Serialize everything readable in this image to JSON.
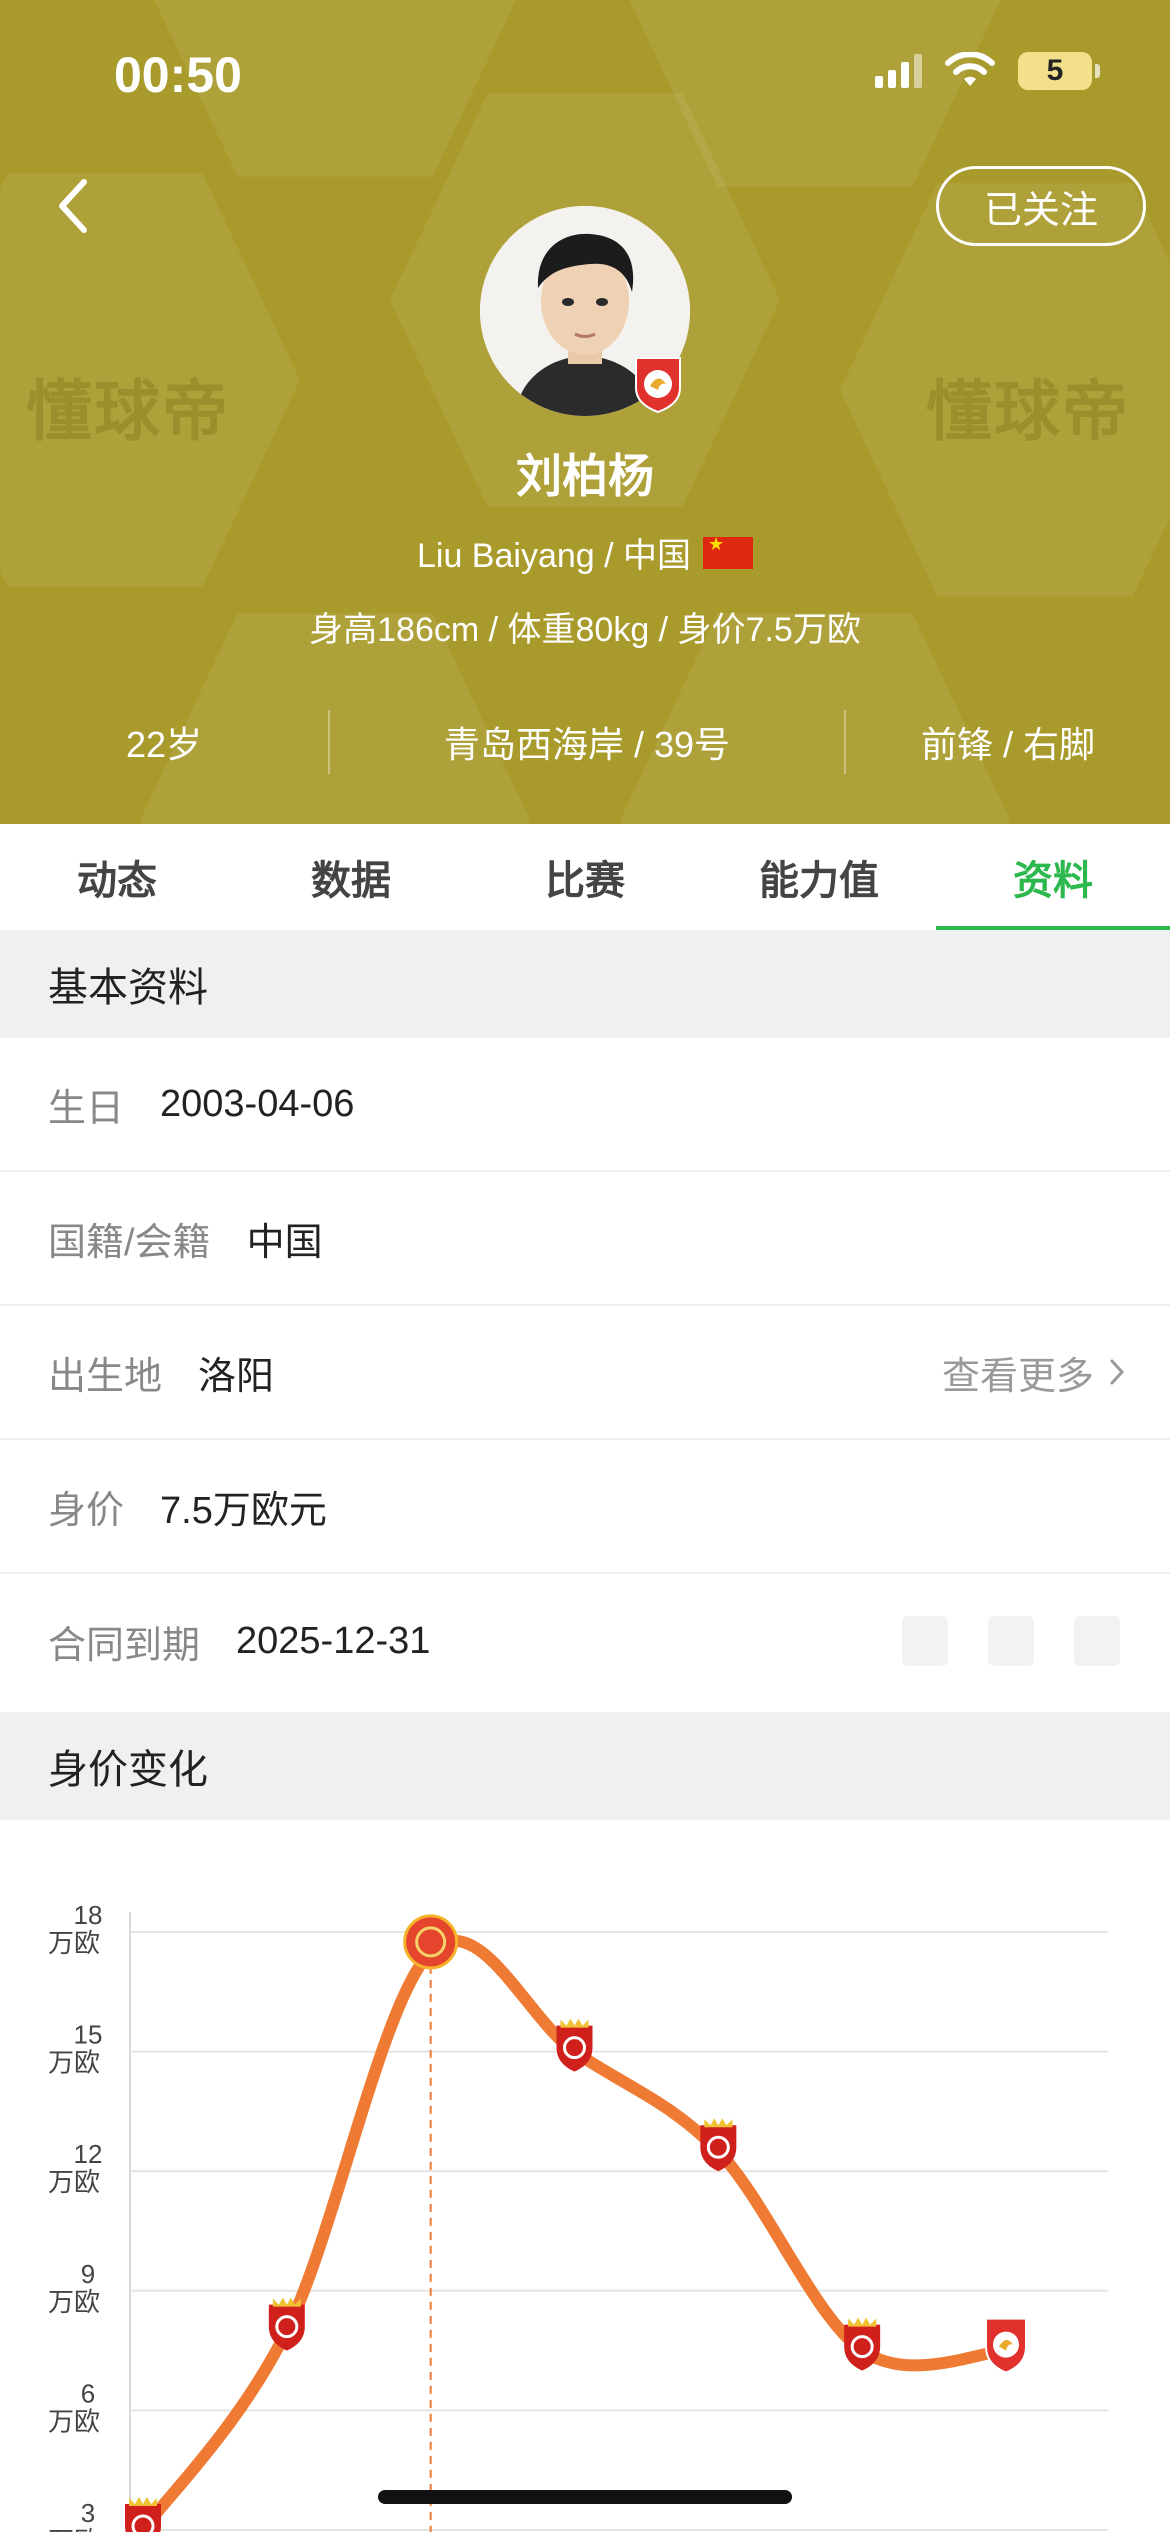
{
  "status_bar": {
    "time": "00:50",
    "battery": "5"
  },
  "header": {
    "watermark": "懂球帝",
    "follow_label": "已关注",
    "name": "刘柏杨",
    "latin_name": "Liu Baiyang / 中国",
    "body_info": "身高186cm / 体重80kg / 身价7.5万欧",
    "age": "22岁",
    "club_number": "青岛西海岸 / 39号",
    "position_foot": "前锋 / 右脚"
  },
  "tabs": [
    {
      "label": "动态"
    },
    {
      "label": "数据"
    },
    {
      "label": "比赛"
    },
    {
      "label": "能力值"
    },
    {
      "label": "资料",
      "active": true
    }
  ],
  "basic_info": {
    "title": "基本资料",
    "rows": [
      {
        "label": "生日",
        "value": "2003-04-06"
      },
      {
        "label": "国籍/会籍",
        "value": "中国"
      },
      {
        "label": "出生地",
        "value": "洛阳",
        "more": "查看更多"
      },
      {
        "label": "身价",
        "value": "7.5万欧元"
      },
      {
        "label": "合同到期",
        "value": "2025-12-31"
      }
    ]
  },
  "value_section": {
    "title": "身价变化"
  },
  "colors": {
    "header_bg": "#a99a2c",
    "accent": "#2db84d",
    "line": "#ee7a33"
  },
  "chart_data": {
    "type": "line",
    "y_unit": "万欧",
    "yticks": [
      3,
      6,
      9,
      12,
      15,
      18
    ],
    "ytick_labels": [
      "3",
      "6",
      "9",
      "12",
      "15",
      "18"
    ],
    "ylim": [
      3,
      18
    ],
    "grid": true,
    "x": [
      0,
      1,
      2,
      3,
      4,
      5,
      6
    ],
    "values": [
      3,
      8,
      17.5,
      15,
      12.5,
      7.5,
      7.5
    ],
    "peak_index": 2,
    "markers": [
      "shanghai-badge",
      "shanghai-badge",
      "cfa-badge",
      "shanghai-badge",
      "shanghai-badge",
      "shanghai-badge",
      "qingdao-badge"
    ]
  }
}
